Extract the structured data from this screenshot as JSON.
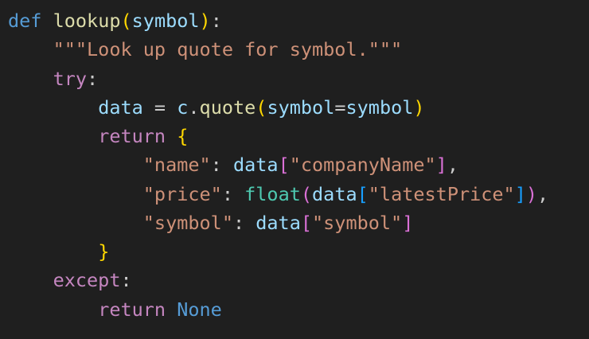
{
  "colors": {
    "background": "#1f1f1f",
    "keyword_storage": "#569cd6",
    "keyword_control": "#c586c0",
    "function": "#dcdcaa",
    "variable": "#9cdcfe",
    "string": "#ce9178",
    "builtin_type": "#4ec9b0",
    "bracket_level1": "#ffd700",
    "bracket_level2": "#da70d6",
    "bracket_level3": "#179fff",
    "punctuation": "#cccccc"
  },
  "code": {
    "language": "python",
    "lines": [
      [
        {
          "text": "def",
          "kind": "keyword_storage"
        },
        {
          "text": " ",
          "kind": "punctuation"
        },
        {
          "text": "lookup",
          "kind": "function"
        },
        {
          "text": "(",
          "kind": "bracket_level1"
        },
        {
          "text": "symbol",
          "kind": "variable"
        },
        {
          "text": ")",
          "kind": "bracket_level1"
        },
        {
          "text": ":",
          "kind": "punctuation"
        }
      ],
      [
        {
          "text": "    ",
          "kind": "punctuation"
        },
        {
          "text": "\"\"\"Look up quote for symbol.\"\"\"",
          "kind": "string"
        }
      ],
      [
        {
          "text": "    ",
          "kind": "punctuation"
        },
        {
          "text": "try",
          "kind": "keyword_control"
        },
        {
          "text": ":",
          "kind": "punctuation"
        }
      ],
      [
        {
          "text": "        ",
          "kind": "punctuation"
        },
        {
          "text": "data",
          "kind": "variable"
        },
        {
          "text": " = ",
          "kind": "punctuation"
        },
        {
          "text": "c",
          "kind": "variable"
        },
        {
          "text": ".",
          "kind": "punctuation"
        },
        {
          "text": "quote",
          "kind": "function"
        },
        {
          "text": "(",
          "kind": "bracket_level1"
        },
        {
          "text": "symbol",
          "kind": "variable"
        },
        {
          "text": "=",
          "kind": "punctuation"
        },
        {
          "text": "symbol",
          "kind": "variable"
        },
        {
          "text": ")",
          "kind": "bracket_level1"
        }
      ],
      [
        {
          "text": "        ",
          "kind": "punctuation"
        },
        {
          "text": "return",
          "kind": "keyword_control"
        },
        {
          "text": " ",
          "kind": "punctuation"
        },
        {
          "text": "{",
          "kind": "bracket_level1"
        }
      ],
      [
        {
          "text": "            ",
          "kind": "punctuation"
        },
        {
          "text": "\"name\"",
          "kind": "string"
        },
        {
          "text": ": ",
          "kind": "punctuation"
        },
        {
          "text": "data",
          "kind": "variable"
        },
        {
          "text": "[",
          "kind": "bracket_level2"
        },
        {
          "text": "\"companyName\"",
          "kind": "string"
        },
        {
          "text": "]",
          "kind": "bracket_level2"
        },
        {
          "text": ",",
          "kind": "punctuation"
        }
      ],
      [
        {
          "text": "            ",
          "kind": "punctuation"
        },
        {
          "text": "\"price\"",
          "kind": "string"
        },
        {
          "text": ": ",
          "kind": "punctuation"
        },
        {
          "text": "float",
          "kind": "builtin_type"
        },
        {
          "text": "(",
          "kind": "bracket_level2"
        },
        {
          "text": "data",
          "kind": "variable"
        },
        {
          "text": "[",
          "kind": "bracket_level3"
        },
        {
          "text": "\"latestPrice\"",
          "kind": "string"
        },
        {
          "text": "]",
          "kind": "bracket_level3"
        },
        {
          "text": ")",
          "kind": "bracket_level2"
        },
        {
          "text": ",",
          "kind": "punctuation"
        }
      ],
      [
        {
          "text": "            ",
          "kind": "punctuation"
        },
        {
          "text": "\"symbol\"",
          "kind": "string"
        },
        {
          "text": ": ",
          "kind": "punctuation"
        },
        {
          "text": "data",
          "kind": "variable"
        },
        {
          "text": "[",
          "kind": "bracket_level2"
        },
        {
          "text": "\"symbol\"",
          "kind": "string"
        },
        {
          "text": "]",
          "kind": "bracket_level2"
        }
      ],
      [
        {
          "text": "        ",
          "kind": "punctuation"
        },
        {
          "text": "}",
          "kind": "bracket_level1"
        }
      ],
      [
        {
          "text": "    ",
          "kind": "punctuation"
        },
        {
          "text": "except",
          "kind": "keyword_control"
        },
        {
          "text": ":",
          "kind": "punctuation"
        }
      ],
      [
        {
          "text": "        ",
          "kind": "punctuation"
        },
        {
          "text": "return",
          "kind": "keyword_control"
        },
        {
          "text": " ",
          "kind": "punctuation"
        },
        {
          "text": "None",
          "kind": "keyword_storage"
        }
      ]
    ]
  }
}
